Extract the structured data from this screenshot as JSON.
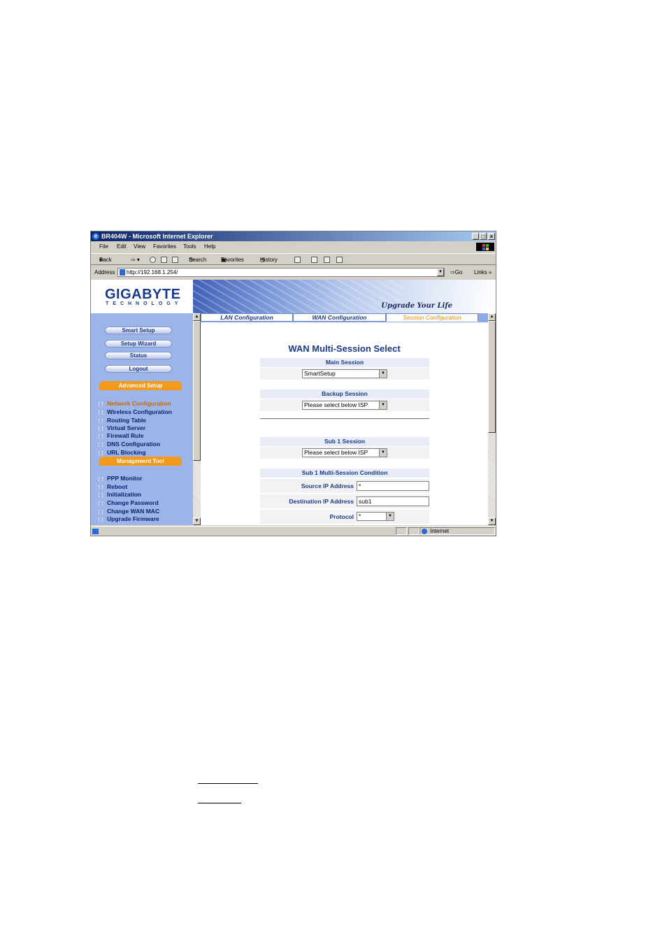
{
  "window": {
    "title": "BR404W - Microsoft Internet Explorer",
    "controls": {
      "minimize": "_",
      "maximize": "□",
      "close": "×"
    }
  },
  "menu": [
    "File",
    "Edit",
    "View",
    "Favorites",
    "Tools",
    "Help"
  ],
  "toolbar": {
    "back": "Back",
    "search": "Search",
    "favorites": "Favorites",
    "history": "History"
  },
  "address": {
    "label": "Address",
    "url": "http://192.168.1.254/",
    "go": "Go",
    "links": "Links »"
  },
  "header": {
    "brand": "GIGABYTE",
    "brand_sub": "TECHNOLOGY",
    "slogan": "Upgrade Your Life"
  },
  "sidebar": {
    "buttons": [
      "Smart Setup",
      "Setup Wizard",
      "Status",
      "Logout"
    ],
    "advanced_title": "Advanced Setup",
    "advanced_items": [
      "Network Configuration",
      "Wireless Configuration",
      "Routing Table",
      "Virtual Server",
      "Firewall Rule",
      "DNS Configuration",
      "URL Blocking"
    ],
    "management_title": "Management Tool",
    "management_items": [
      "PPP Monitor",
      "Reboot",
      "Initialization",
      "Change Password",
      "Change WAN MAC",
      "Upgrade Firmware"
    ],
    "active_item": "Network Configuration"
  },
  "tabs": [
    "LAN Configuration",
    "WAN Configuration",
    "Session Configuration"
  ],
  "active_tab": "Session Configuration",
  "main": {
    "title": "WAN Multi-Session Select",
    "main_session": {
      "label": "Main Session",
      "value": "SmartSetup"
    },
    "backup_session": {
      "label": "Backup Session",
      "value": "Please select below ISP"
    },
    "sub1_session": {
      "label": "Sub 1 Session",
      "value": "Please select below ISP"
    },
    "condition": {
      "label": "Sub 1 Multi-Session Condition",
      "source_label": "Source IP Address",
      "source_value": "*",
      "dest_label": "Destination IP Address",
      "dest_value": "sub1",
      "protocol_label": "Protocol",
      "protocol_value": "*"
    }
  },
  "status": {
    "zone": "Internet"
  },
  "colors": {
    "accent": "#1b3a8c",
    "orange": "#f39a1b",
    "nav_bg": "#9db4e8"
  }
}
